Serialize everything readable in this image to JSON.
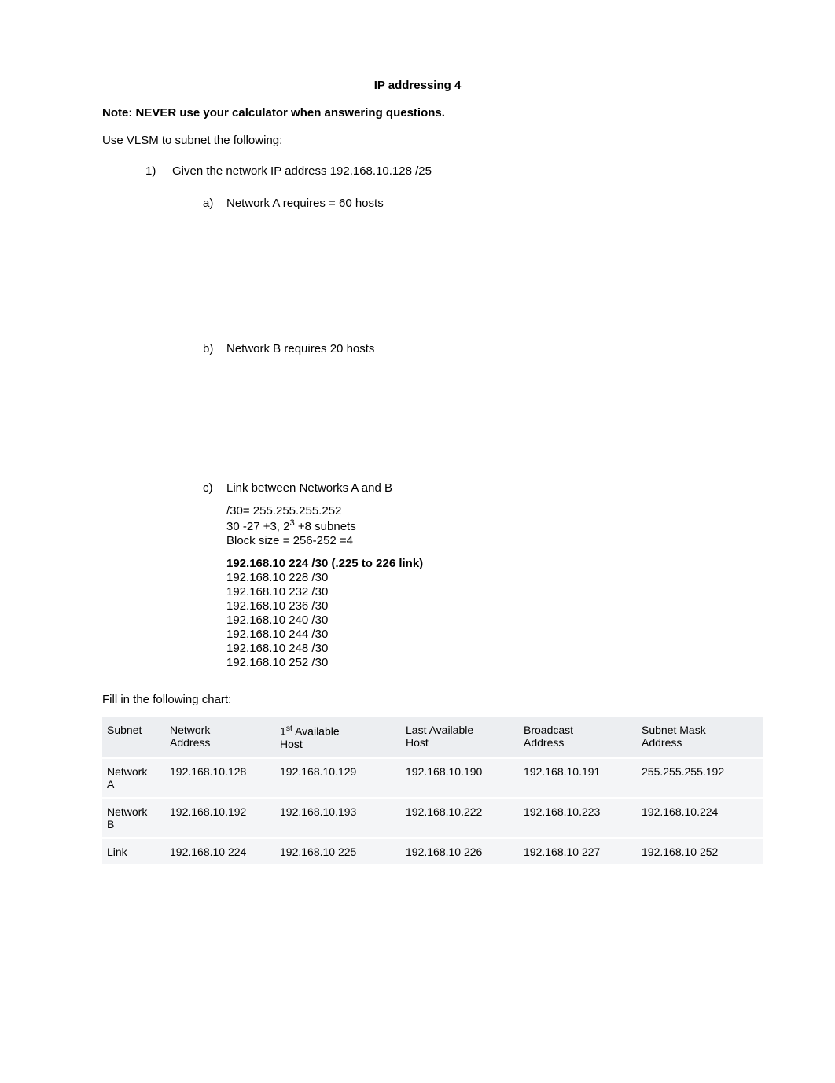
{
  "title": "IP addressing 4",
  "note": "Note: NEVER use your calculator when answering questions.",
  "intro": "Use VLSM to subnet the following:",
  "q1": {
    "marker": "1)",
    "text": "Given the network IP address 192.168.10.128 /25"
  },
  "subA": {
    "marker": "a)",
    "text": "Network A requires = 60 hosts"
  },
  "subB": {
    "marker": "b)",
    "text": "Network B requires 20 hosts"
  },
  "subC": {
    "marker": "c)",
    "text": "Link between Networks A and B"
  },
  "answerC": {
    "l1": "/30= 255.255.255.252",
    "l2_pre": "30 -27 +3, 2",
    "l2_sup": "3",
    "l2_post": " +8 subnets",
    "l3": "Block size = 256-252 =4",
    "l4": "192.168.10 224 /30 (.225 to 226 link)",
    "l5": "192.168.10 228 /30",
    "l6": "192.168.10 232 /30",
    "l7": "192.168.10 236 /30",
    "l8": "192.168.10 240 /30",
    "l9": "192.168.10 244 /30",
    "l10": "192.168.10 248 /30",
    "l11": "192.168.10 252 /30"
  },
  "chartNote": "Fill in the following chart:",
  "table": {
    "headers": {
      "c0": "Subnet",
      "c1a": "Network",
      "c1b": "Address",
      "c2a_pre": "1",
      "c2a_sup": "st",
      "c2a_post": " Available",
      "c2b": "Host",
      "c3a": "Last Available",
      "c3b": "Host",
      "c4a": "Broadcast",
      "c4b": "Address",
      "c5a": "Subnet Mask",
      "c5b": "Address"
    },
    "rows": [
      {
        "c0a": "Network",
        "c0b": "A",
        "c1": "192.168.10.128",
        "c2": "192.168.10.129",
        "c3": "192.168.10.190",
        "c4": "192.168.10.191",
        "c5": "255.255.255.192"
      },
      {
        "c0a": "Network",
        "c0b": "B",
        "c1": "192.168.10.192",
        "c2": "192.168.10.193",
        "c3": "192.168.10.222",
        "c4": "192.168.10.223",
        "c5": "192.168.10.224"
      },
      {
        "c0a": "Link",
        "c0b": "",
        "c1": "192.168.10 224",
        "c2": "192.168.10 225",
        "c3": "192.168.10 226",
        "c4": "192.168.10 227",
        "c5": "192.168.10 252"
      }
    ]
  }
}
